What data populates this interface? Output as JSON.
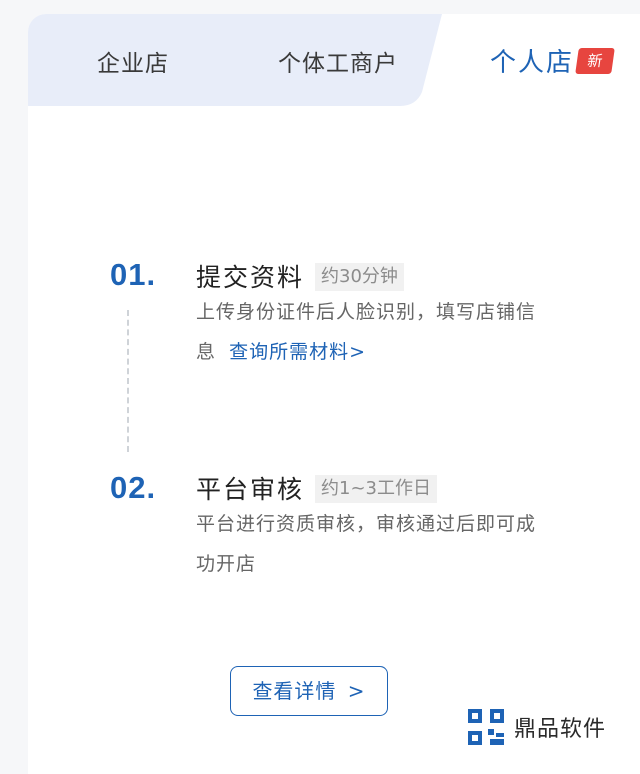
{
  "tabs": [
    {
      "label": "企业店",
      "selected": false
    },
    {
      "label": "个体工商户",
      "selected": false
    },
    {
      "label": "个人店",
      "selected": true,
      "badge": "新"
    }
  ],
  "steps": [
    {
      "number": "01.",
      "title": "提交资料",
      "time": "约30分钟",
      "description_line1": "上传身份证件后人脸识别，填写店铺信",
      "description_line2": "息",
      "link": "查询所需材料>"
    },
    {
      "number": "02.",
      "title": "平台审核",
      "time": "约1~3工作日",
      "description_line1": "平台进行资质审核，审核通过后即可成",
      "description_line2": "功开店"
    }
  ],
  "details_button": {
    "label": "查看详情",
    "chevron": ">"
  },
  "watermark": {
    "text": "鼎品软件",
    "icon": "qr-logo-icon"
  },
  "colors": {
    "accent": "#1e63b5",
    "badge": "#e7453f",
    "tab_bg": "#e8edf9",
    "page_bg": "#f6f7f9"
  }
}
